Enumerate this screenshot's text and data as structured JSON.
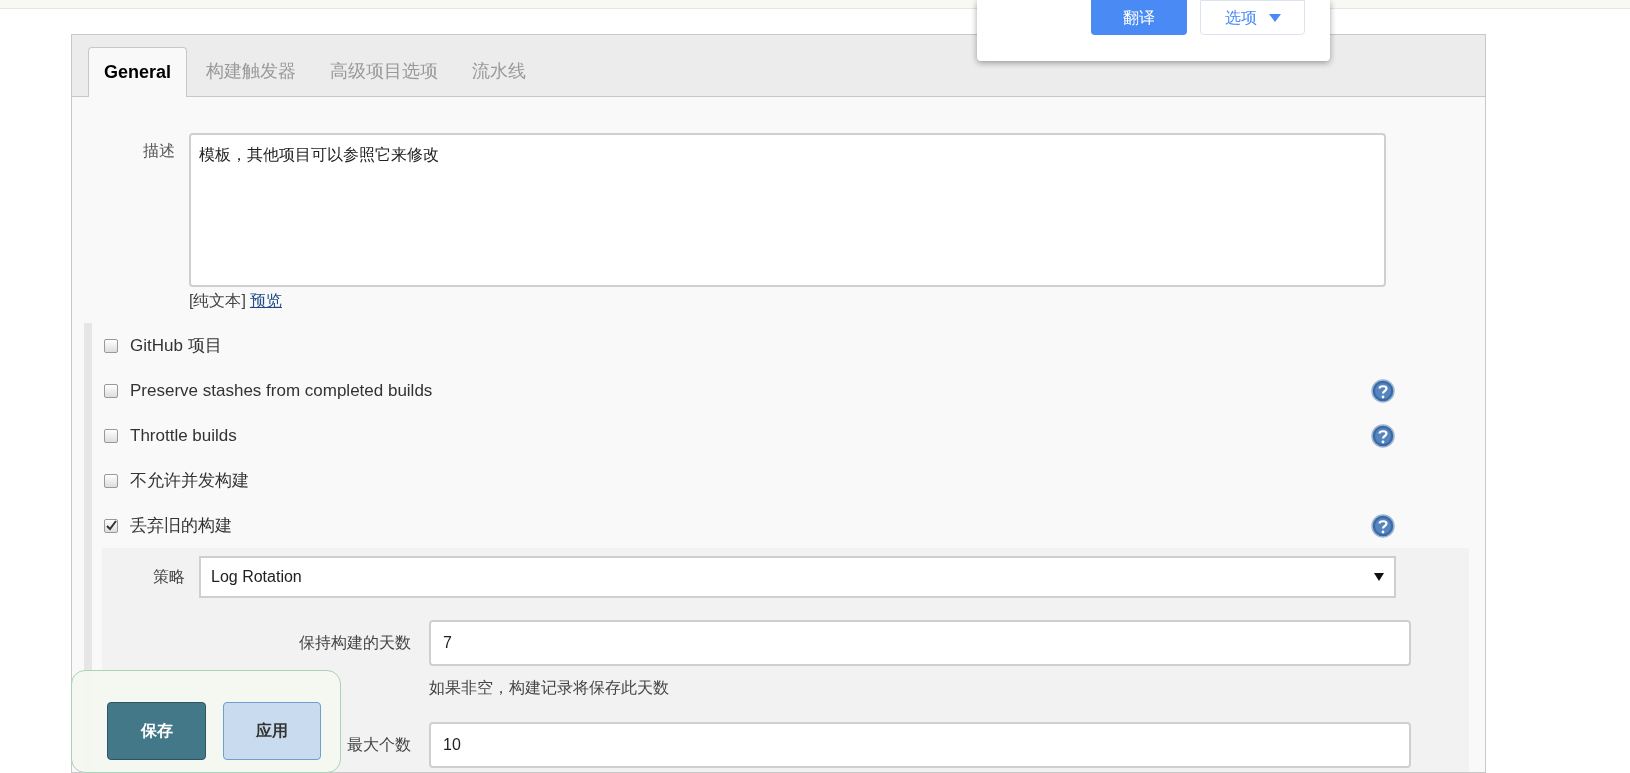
{
  "translate_popup": {
    "translate_button": "翻译",
    "options_button": "选项"
  },
  "tabs": [
    {
      "label": "General",
      "selected": true
    },
    {
      "label": "构建触发器",
      "selected": false
    },
    {
      "label": "高级项目选项",
      "selected": false
    },
    {
      "label": "流水线",
      "selected": false
    }
  ],
  "description": {
    "label": "描述",
    "value": "模板，其他项目可以参照它来修改",
    "format": "[纯文本]",
    "preview_link": "预览"
  },
  "options": [
    {
      "label": "GitHub 项目",
      "checked": false,
      "help": false
    },
    {
      "label": "Preserve stashes from completed builds",
      "checked": false,
      "help": true
    },
    {
      "label": "Throttle builds",
      "checked": false,
      "help": true
    },
    {
      "label": "不允许并发构建",
      "checked": false,
      "help": false
    },
    {
      "label": "丢弃旧的构建",
      "checked": true,
      "help": true
    }
  ],
  "strategy": {
    "label": "策略",
    "value": "Log Rotation"
  },
  "fields": [
    {
      "label": "保持构建的天数",
      "value": "7",
      "hint": "如果非空，构建记录将保存此天数"
    },
    {
      "label": "最大个数",
      "value": "10"
    }
  ],
  "save_bar": {
    "save": "保存",
    "apply": "应用"
  }
}
